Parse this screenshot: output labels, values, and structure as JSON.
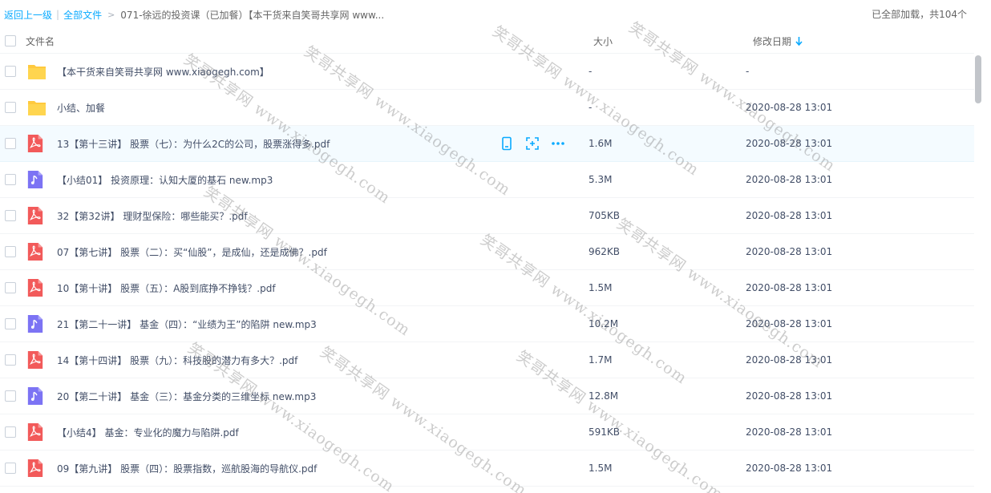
{
  "breadcrumb": {
    "back_label": "返回上一级",
    "all_files_label": "全部文件",
    "current_label": "071-徐远的投资课（已加餐）【本干货来自笑哥共享网 www..."
  },
  "status": {
    "loaded_text": "已全部加载，共104个"
  },
  "header": {
    "name_label": "文件名",
    "size_label": "大小",
    "date_label": "修改日期"
  },
  "colors": {
    "accent": "#09aaff",
    "folder": "#ffd04b",
    "pdf": "#f55050",
    "audio": "#7d75f5"
  },
  "files": [
    {
      "type": "folder",
      "icon": "folder-icon",
      "name": "【本干货来自笑哥共享网 www.xiaogegh.com】",
      "size": "-",
      "date": "-"
    },
    {
      "type": "folder",
      "icon": "folder-icon",
      "name": "小结、加餐",
      "size": "-",
      "date": "2020-08-28 13:01"
    },
    {
      "type": "pdf",
      "icon": "pdf-icon",
      "name": "13【第十三讲】 股票（七）：为什么2C的公司，股票涨得多.pdf",
      "size": "1.6M",
      "date": "2020-08-28 13:01"
    },
    {
      "type": "audio",
      "icon": "audio-icon",
      "name": "【小结01】 投资原理：认知大厦的基石 new.mp3",
      "size": "5.3M",
      "date": "2020-08-28 13:01"
    },
    {
      "type": "pdf",
      "icon": "pdf-icon",
      "name": "32【第32讲】 理财型保险：哪些能买？.pdf",
      "size": "705KB",
      "date": "2020-08-28 13:01"
    },
    {
      "type": "pdf",
      "icon": "pdf-icon",
      "name": "07【第七讲】 股票（二）：买“仙股”，是成仙，还是成佛？.pdf",
      "size": "962KB",
      "date": "2020-08-28 13:01"
    },
    {
      "type": "pdf",
      "icon": "pdf-icon",
      "name": "10【第十讲】 股票（五）：A股到底挣不挣钱？.pdf",
      "size": "1.5M",
      "date": "2020-08-28 13:01"
    },
    {
      "type": "audio",
      "icon": "audio-icon",
      "name": "21【第二十一讲】 基金（四）：“业绩为王”的陷阱 new.mp3",
      "size": "10.2M",
      "date": "2020-08-28 13:01"
    },
    {
      "type": "pdf",
      "icon": "pdf-icon",
      "name": "14【第十四讲】 股票（九）：科技股的潜力有多大？.pdf",
      "size": "1.7M",
      "date": "2020-08-28 13:01"
    },
    {
      "type": "audio",
      "icon": "audio-icon",
      "name": "20【第二十讲】 基金（三）：基金分类的三维坐标 new.mp3",
      "size": "12.8M",
      "date": "2020-08-28 13:01"
    },
    {
      "type": "pdf",
      "icon": "pdf-icon",
      "name": "【小结4】 基金：专业化的魔力与陷阱.pdf",
      "size": "591KB",
      "date": "2020-08-28 13:01"
    },
    {
      "type": "pdf",
      "icon": "pdf-icon",
      "name": "09【第九讲】 股票（四）：股票指数，巡航股海的导航仪.pdf",
      "size": "1.5M",
      "date": "2020-08-28 13:01"
    }
  ],
  "watermark": {
    "text": "笑哥共享网 www.xiaogegh.com"
  }
}
